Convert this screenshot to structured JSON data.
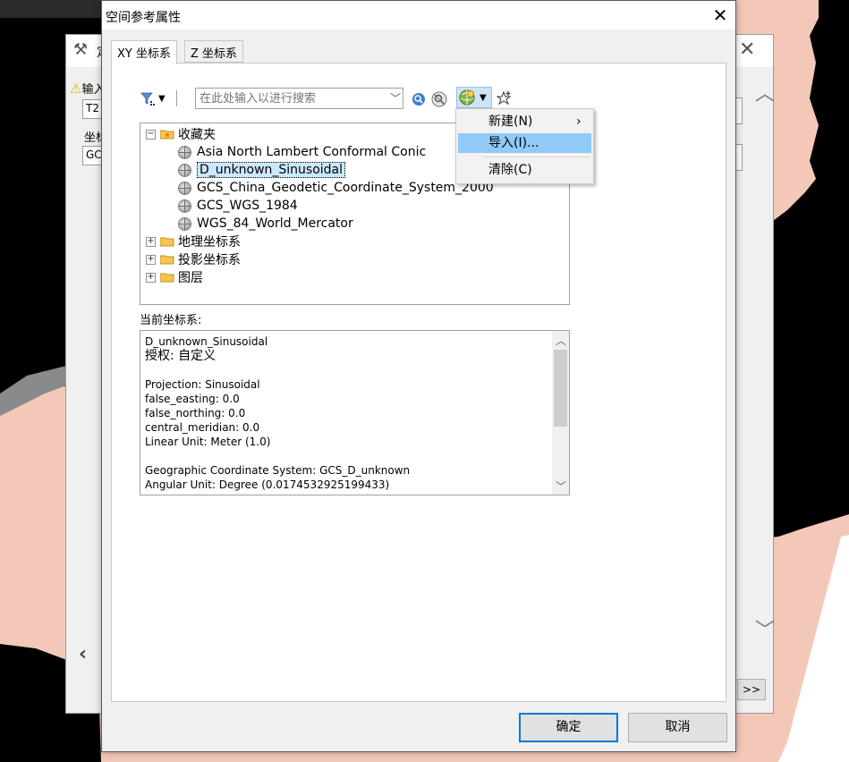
{
  "background_dialog": {
    "title": "定",
    "warning_label": "输入",
    "field1_value": "T2",
    "label2": "坐标",
    "field2_value": "GC",
    "more_button": ">>"
  },
  "dialog": {
    "title": "空间参考属性",
    "close_glyph": "✕"
  },
  "tabs": [
    {
      "label": "XY 坐标系",
      "active": true
    },
    {
      "label": "Z 坐标系",
      "active": false
    }
  ],
  "toolbar": {
    "search_placeholder": "在此处输入以进行搜索"
  },
  "tree": {
    "favorites": {
      "label": "收藏夹",
      "items": [
        {
          "label": "Asia North Lambert Conformal Conic"
        },
        {
          "label": "D_unknown_Sinusoidal",
          "selected": true
        },
        {
          "label": "GCS_China_Geodetic_Coordinate_System_2000"
        },
        {
          "label": "GCS_WGS_1984"
        },
        {
          "label": "WGS_84_World_Mercator"
        }
      ]
    },
    "folders": [
      {
        "label": "地理坐标系"
      },
      {
        "label": "投影坐标系"
      },
      {
        "label": "图层"
      }
    ]
  },
  "current_system": {
    "label": "当前坐标系:",
    "name": "D_unknown_Sinusoidal",
    "authority": "授权: 自定义",
    "lines": [
      "Projection: Sinusoidal",
      "false_easting: 0.0",
      "false_northing: 0.0",
      "central_meridian: 0.0",
      "Linear Unit: Meter (1.0)",
      "",
      "Geographic Coordinate System: GCS_D_unknown",
      "Angular Unit: Degree (0.0174532925199433)"
    ]
  },
  "menu": {
    "items": [
      {
        "label": "新建(N)",
        "has_submenu": true,
        "submenu_glyph": "›"
      },
      {
        "label": "导入(I)...",
        "hover": true
      },
      {
        "label": "清除(C)"
      }
    ]
  },
  "buttons": {
    "ok": "确定",
    "cancel": "取消"
  },
  "colors": {
    "accent": "#0078d7",
    "selection": "#cce8ff",
    "menu_hover": "#91c9f7",
    "map_fill": "#f3c8b8"
  }
}
